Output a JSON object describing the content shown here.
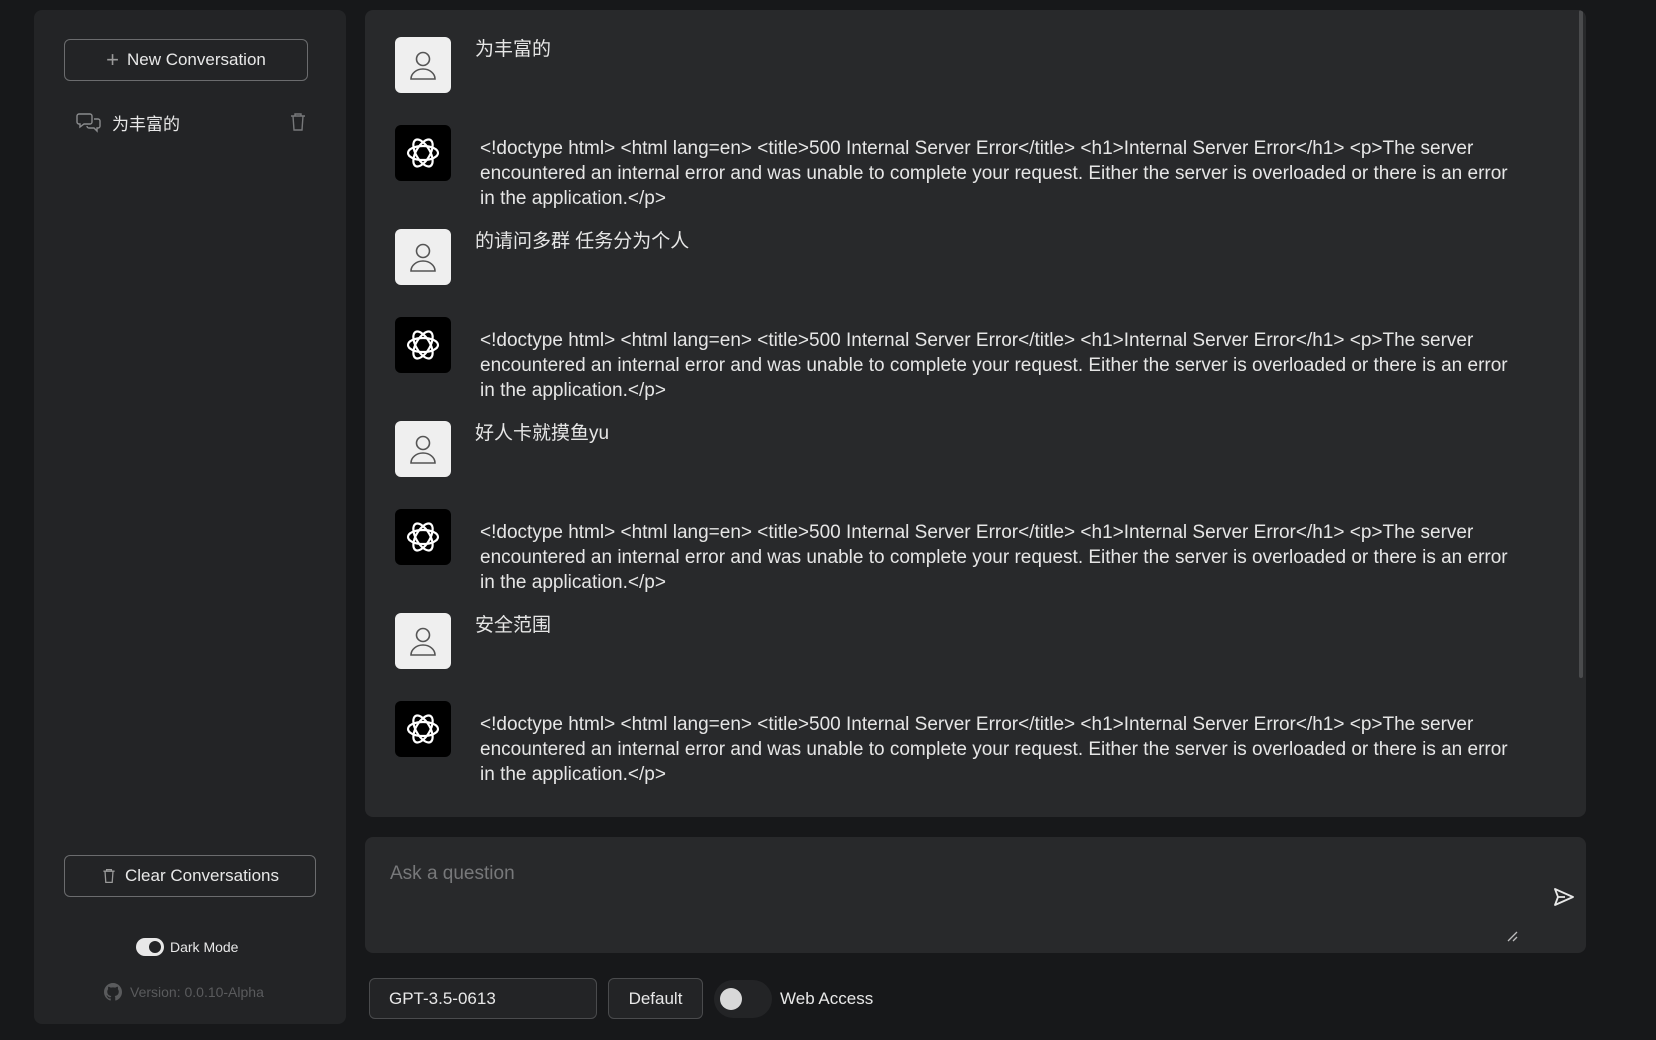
{
  "sidebar": {
    "new_conversation_label": "New Conversation",
    "conversations": [
      {
        "title": "为丰富的"
      }
    ],
    "clear_label": "Clear Conversations",
    "dark_mode_label": "Dark Mode",
    "dark_mode_on": true,
    "version": "Version: 0.0.10-Alpha"
  },
  "chat": {
    "messages": [
      {
        "role": "user",
        "text": "为丰富的"
      },
      {
        "role": "assistant",
        "text": "<!doctype html> <html lang=en> <title>500 Internal Server Error</title> <h1>Internal Server Error</h1> <p>The server encountered an internal error and was unable to complete your request. Either the server is overloaded or there is an error in the application.</p>"
      },
      {
        "role": "user",
        "text": "的请问多群 任务分为个人"
      },
      {
        "role": "assistant",
        "text": "<!doctype html> <html lang=en> <title>500 Internal Server Error</title> <h1>Internal Server Error</h1> <p>The server encountered an internal error and was unable to complete your request. Either the server is overloaded or there is an error in the application.</p>"
      },
      {
        "role": "user",
        "text": "好人卡就摸鱼yu"
      },
      {
        "role": "assistant",
        "text": "<!doctype html> <html lang=en> <title>500 Internal Server Error</title> <h1>Internal Server Error</h1> <p>The server encountered an internal error and was unable to complete your request. Either the server is overloaded or there is an error in the application.</p>"
      },
      {
        "role": "user",
        "text": "安全范围"
      },
      {
        "role": "assistant",
        "text": "<!doctype html> <html lang=en> <title>500 Internal Server Error</title> <h1>Internal Server Error</h1> <p>The server encountered an internal error and was unable to complete your request. Either the server is overloaded or there is an error in the application.</p>"
      }
    ]
  },
  "input": {
    "placeholder": "Ask a question",
    "value": ""
  },
  "bottom_bar": {
    "model": "GPT-3.5-0613",
    "preset": "Default",
    "web_access_label": "Web Access",
    "web_access_on": false
  },
  "icons": {
    "new": "plus-icon",
    "conversation": "chat-bubbles-icon",
    "delete": "trash-icon",
    "user_avatar": "user-icon",
    "bot_avatar": "openai-logo-icon",
    "send": "send-icon",
    "github": "github-icon"
  }
}
